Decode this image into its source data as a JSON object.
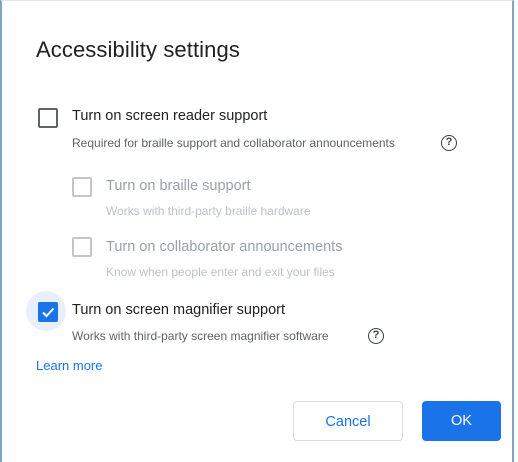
{
  "dialog": {
    "title": "Accessibility settings",
    "options": [
      {
        "label": "Turn on screen reader support",
        "description": "Required for braille support and collaborator announcements",
        "checked": false,
        "disabled": false,
        "has_help": true
      },
      {
        "label": "Turn on braille support",
        "description": "Works with third-party braille hardware",
        "checked": false,
        "disabled": true,
        "has_help": false
      },
      {
        "label": "Turn on collaborator announcements",
        "description": "Know when people enter and exit your files",
        "checked": false,
        "disabled": true,
        "has_help": false
      },
      {
        "label": "Turn on screen magnifier support",
        "description": "Works with third-party screen magnifier software",
        "checked": true,
        "disabled": false,
        "has_help": true
      }
    ],
    "help_glyph": "?",
    "learn_more": "Learn more",
    "cancel_label": "Cancel",
    "ok_label": "OK"
  },
  "colors": {
    "accent": "#1a73e8",
    "text": "#202124",
    "secondary_text": "#5f6368",
    "disabled_text": "#9aa0a6"
  },
  "icons": {
    "help": "help-circle-icon",
    "check": "checkmark-icon"
  }
}
